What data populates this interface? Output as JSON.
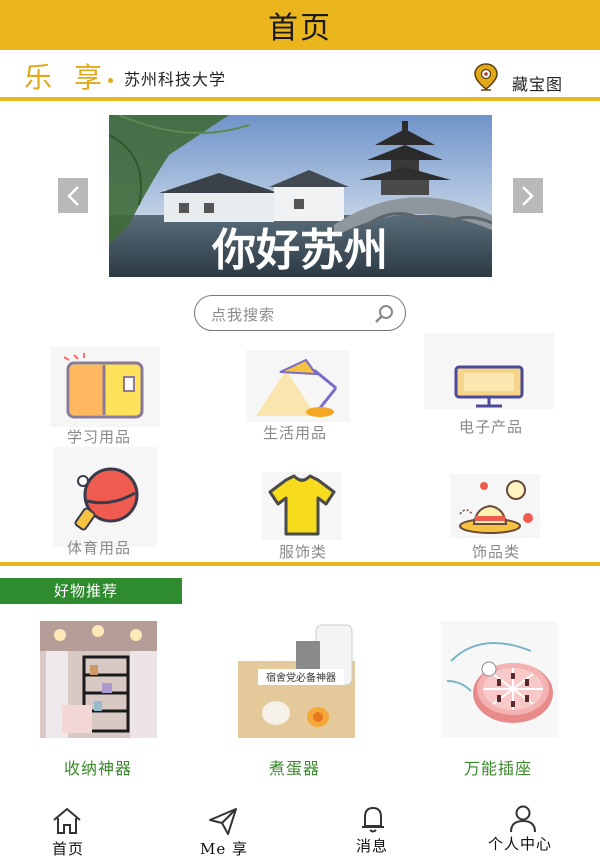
{
  "header": {
    "title": "首页"
  },
  "subbar": {
    "logo_chars": [
      "乐",
      "享"
    ],
    "school": "苏州科技大学",
    "map_label": "藏宝图",
    "map_icon": "map-pin-icon"
  },
  "banner": {
    "caption": "你好苏州",
    "prev_icon": "chevron-left-icon",
    "next_icon": "chevron-right-icon"
  },
  "search": {
    "placeholder": "点我搜索",
    "icon": "search-icon"
  },
  "categories": [
    {
      "label": "学习用品",
      "icon": "notebook-icon"
    },
    {
      "label": "生活用品",
      "icon": "desk-lamp-icon"
    },
    {
      "label": "电子产品",
      "icon": "monitor-icon"
    },
    {
      "label": "体育用品",
      "icon": "ping-pong-paddle-icon"
    },
    {
      "label": "服饰类",
      "icon": "t-shirt-icon"
    },
    {
      "label": "饰品类",
      "icon": "hat-accessory-icon"
    }
  ],
  "recommend": {
    "title": "好物推荐",
    "items": [
      {
        "label": "收纳神器"
      },
      {
        "label": "煮蛋器",
        "overlay": "宿舍党必备神器"
      },
      {
        "label": "万能插座"
      }
    ]
  },
  "tabbar": {
    "items": [
      {
        "label": "首页",
        "icon": "home-icon"
      },
      {
        "label": "Me 享",
        "icon": "paper-plane-icon"
      },
      {
        "label": "消息",
        "icon": "bell-icon"
      },
      {
        "label": "个人中心",
        "icon": "user-icon"
      }
    ]
  },
  "colors": {
    "accent": "#ebb51d",
    "green": "#2e8b2e",
    "label_green": "#3b8a2c"
  }
}
